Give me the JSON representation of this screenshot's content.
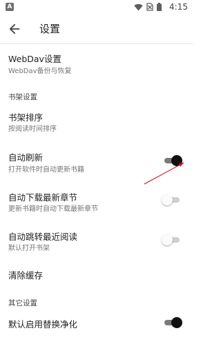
{
  "status_bar": {
    "app_icon_letter": "A",
    "time": "4:15",
    "icons": [
      "wifi-icon",
      "no-sim-icon",
      "battery-icon"
    ]
  },
  "app_bar": {
    "back_icon": "arrow-left-icon",
    "title": "设置"
  },
  "settings": {
    "webdav": {
      "title": "WebDav设置",
      "subtitle": "WebDav备份与恢复"
    },
    "bookshelf_section": "书架设置",
    "sort": {
      "title": "书架排序",
      "subtitle": "按阅读时间排序"
    },
    "auto_refresh": {
      "title": "自动刷新",
      "subtitle": "打开软件时自动更新书籍",
      "checked": true
    },
    "auto_download": {
      "title": "自动下载最新章节",
      "subtitle": "更新书籍时自动下载最新章节",
      "checked": false
    },
    "auto_jump": {
      "title": "自动跳转最近阅读",
      "subtitle": "默认打开书架",
      "checked": false
    },
    "clear_cache": {
      "title": "清除缓存"
    },
    "other_section": "其它设置",
    "replace_purify": {
      "title": "默认启用替换净化",
      "checked": true
    }
  },
  "colors": {
    "switch_on_thumb": "#111111",
    "switch_on_track": "#7a7a7a",
    "switch_off_thumb": "#fbfbfb",
    "switch_off_track": "#cfcfcf",
    "annotation_arrow": "#d0021b"
  }
}
